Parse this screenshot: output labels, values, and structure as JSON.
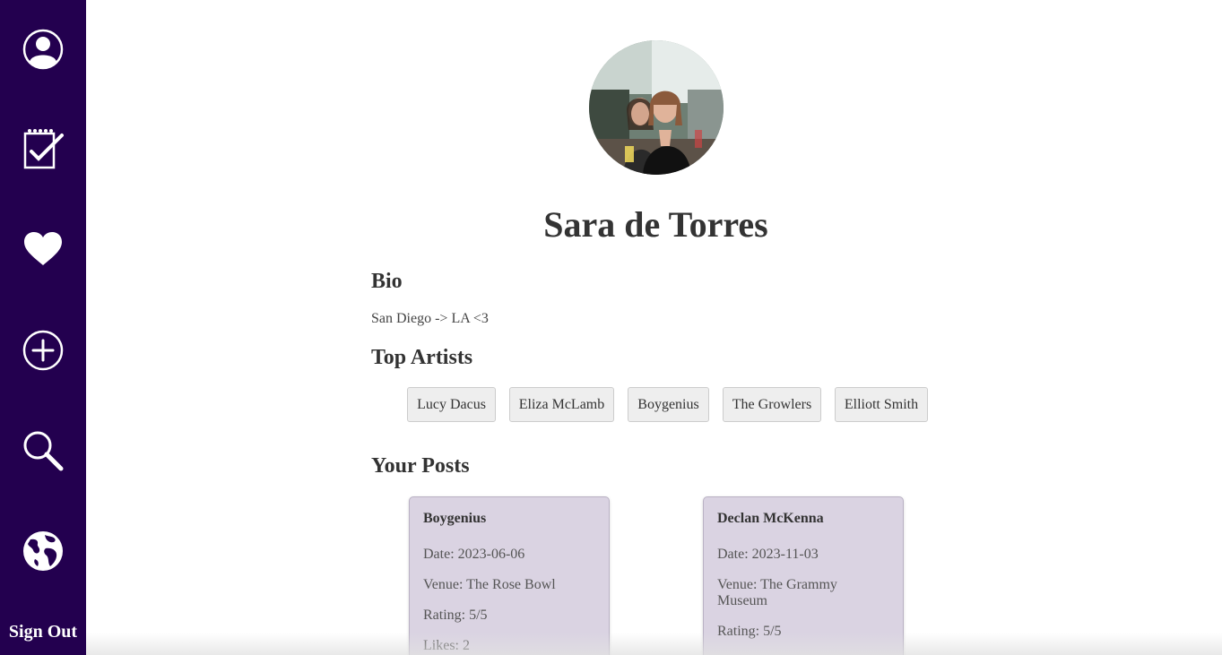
{
  "sidebar": {
    "items": [
      {
        "icon": "profile-icon"
      },
      {
        "icon": "checklist-icon"
      },
      {
        "icon": "heart-icon"
      },
      {
        "icon": "add-icon"
      },
      {
        "icon": "search-icon"
      },
      {
        "icon": "globe-icon"
      }
    ],
    "signout_label": "Sign Out",
    "background": "#23004f"
  },
  "profile": {
    "name": "Sara de Torres",
    "bio_heading": "Bio",
    "bio": "San Diego -> LA <3",
    "top_artists_heading": "Top Artists",
    "top_artists": [
      "Lucy Dacus",
      "Eliza McLamb",
      "Boygenius",
      "The Growlers",
      "Elliott Smith"
    ]
  },
  "posts": {
    "heading": "Your Posts",
    "items": [
      {
        "artist": "Boygenius",
        "date": "Date: 2023-06-06",
        "venue": "Venue: The Rose Bowl",
        "rating": "Rating: 5/5",
        "likes": "Likes: 2"
      },
      {
        "artist": "Declan McKenna",
        "date": "Date: 2023-11-03",
        "venue": "Venue: The Grammy Museum",
        "rating": "Rating: 5/5"
      }
    ],
    "card_color": "#dad3e2"
  }
}
